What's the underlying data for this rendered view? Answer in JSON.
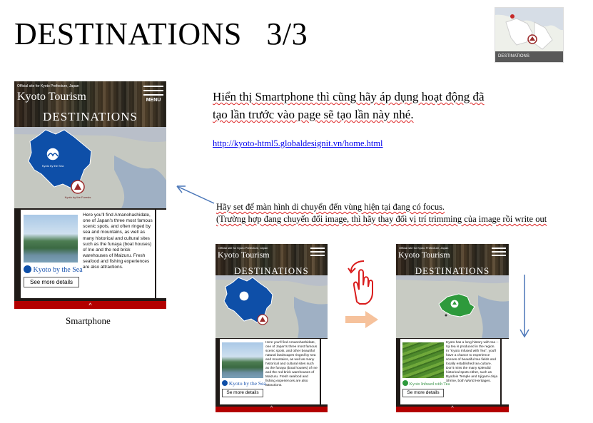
{
  "slide": {
    "title": "DESTINATIONS",
    "page": "3/3"
  },
  "thumbnail": {
    "bar_label": "DESTINATIONS"
  },
  "phone_main": {
    "official": "Official site for Kyoto Prefecture, Japan",
    "brand": "Kyoto Tourism",
    "menu_label": "MENU",
    "title": "DESTINATIONS",
    "region_top_label": "Kyoto by the Sea",
    "region_bottom_label": "Kyoto by the Forests",
    "card_caption": "Kyoto by the Sea",
    "card_button": "See more details",
    "card_desc": "Here you'll find Amanohashidate, one of Japan's three most famous scenic spots, and often ringed by sea and mountains, as well as many historical and cultural sites such as the funaya (boat houses) of Ine and the red brick warehouses of Maizuru. Fresh seafood and fishing experiences are also attractions.",
    "footer_chevron": "^"
  },
  "caption_smartphone": "Smartphone",
  "instruction": {
    "line1": "Hiển thị Smartphone thì cũng hãy áp dụng hoạt động đã",
    "line2": "tạo lần trước vào page sẽ tạo lần này nhé.",
    "link": "http://kyoto-html5.globaldesignit.vn/home.html",
    "note1": "Hãy set để màn hình di chuyển đến vùng hiện tại đang có focus.",
    "note2": "(Trường hợp đang chuyển đổi image, thì hãy thay đổi vị trí trimming của image rồi write out"
  },
  "phone_before": {
    "brand": "Kyoto Tourism",
    "official": "Official site for Kyoto Prefecture, Japan",
    "title": "DESTINATIONS",
    "card_caption": "Kyoto by the Sea",
    "card_button": "Se more details",
    "card_desc": "Here you'll find Amanohashidate, one of Japan's three most famous scenic spots, and other beautiful natural landscapes ringed by sea and mountains, as well as many historical and cultural sites such as the funaya (boat houses) of Ine and the red brick warehouses of Maizuru. Fresh seafood and fishing experiences are also attractions."
  },
  "phone_after": {
    "brand": "Kyoto Tourism",
    "official": "Official site for Kyoto Prefecture, Japan",
    "title": "DESTINATIONS",
    "card_caption": "Kyoto Infused with Tea",
    "card_button": "Se more details",
    "card_desc": "Kyoto has a long history with tea -- Uji tea is produced in the region. In \"Kyoto Infused with Tea\", you'll have a chance to experience scenes of beautiful tea fields and locally established tea culture. Don't miss the many splendid historical spots either, such as Byodoin Temple and Ujigami-Jinja Shrine, both World Heritages."
  },
  "colors": {
    "sea_region": "#0e4fa8",
    "tea_region": "#2e9a3c",
    "footer_red": "#b30000",
    "arrow_blue": "#4a76b8",
    "arrow_orange": "#f6c29c",
    "gesture_red": "#d91c1c"
  }
}
